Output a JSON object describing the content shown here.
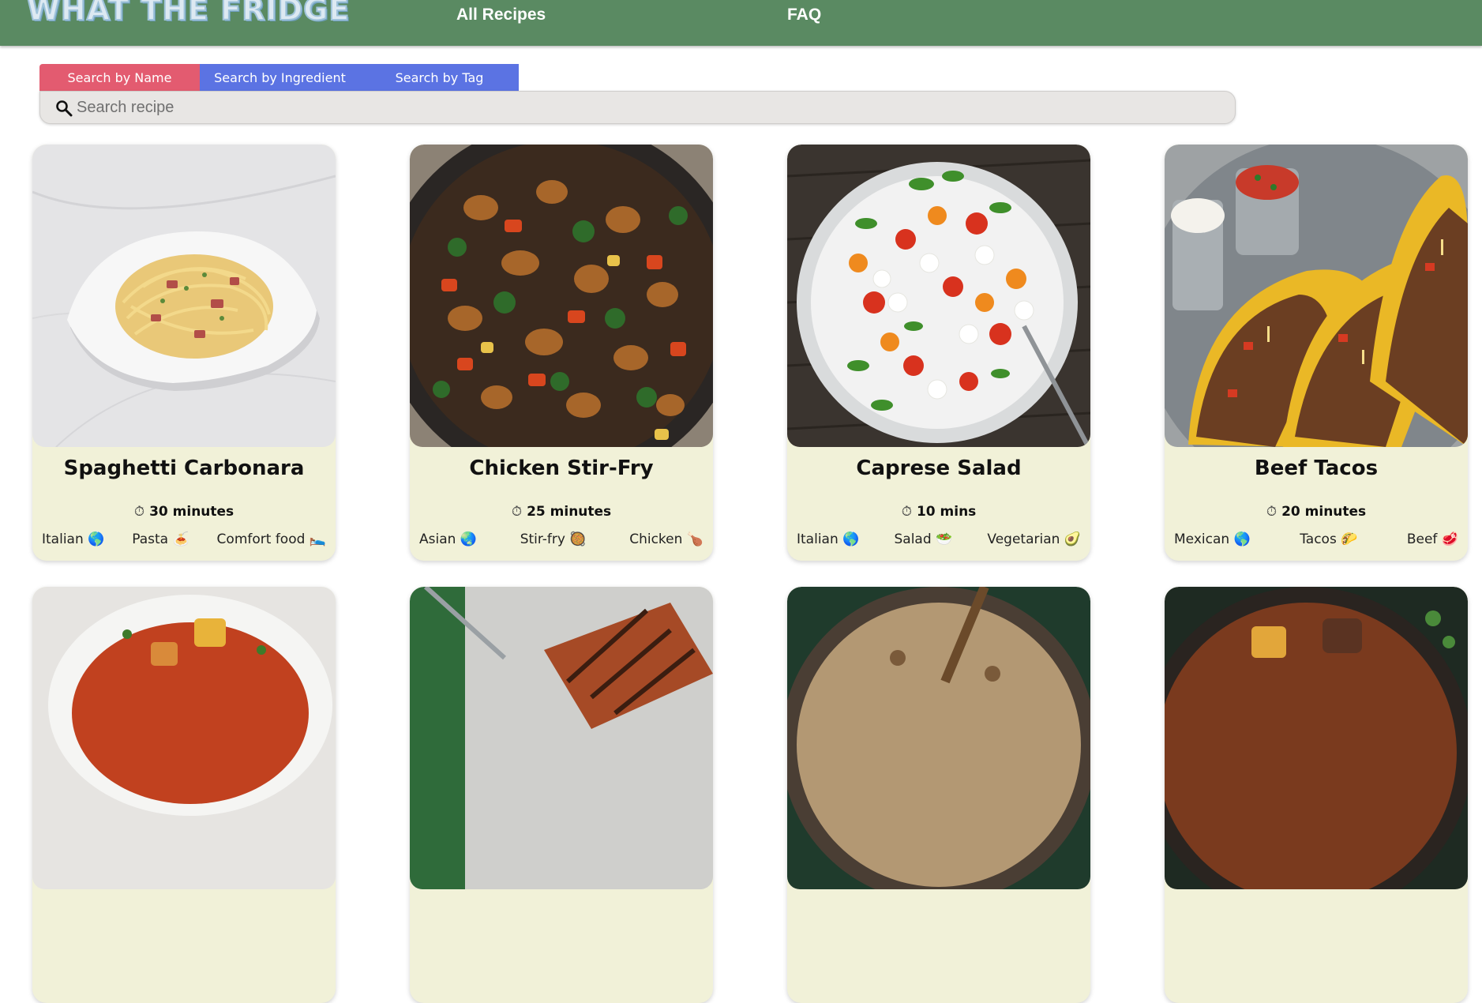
{
  "header": {
    "logo": "WHAT THE FRIDGE",
    "nav": [
      "All Recipes",
      "FAQ"
    ]
  },
  "search": {
    "tabs": [
      "Search by Name",
      "Search by Ingredient",
      "Search by Tag"
    ],
    "placeholder": "Search recipe"
  },
  "colors": {
    "header_bg": "#5a8a62",
    "tab_active": "#e35b70",
    "tab_inactive": "#5b73e3",
    "card_bg": "#f1f1d8"
  },
  "recipes": [
    {
      "title": "Spaghetti Carbonara",
      "time": "30 minutes",
      "tags": [
        "Italian 🌎",
        "Pasta 🍝",
        "Comfort food 🛌"
      ]
    },
    {
      "title": "Chicken Stir-Fry",
      "time": "25 minutes",
      "tags": [
        "Asian 🌏",
        "Stir-fry 🥘",
        "Chicken 🍗"
      ]
    },
    {
      "title": "Caprese Salad",
      "time": "10 mins",
      "tags": [
        "Italian 🌎",
        "Salad 🥗",
        "Vegetarian 🥑"
      ]
    },
    {
      "title": "Beef Tacos",
      "time": "20 minutes",
      "tags": [
        "Mexican 🌎",
        "Tacos 🌮",
        "Beef 🥩"
      ]
    }
  ],
  "timer_icon": "stopwatch-icon"
}
